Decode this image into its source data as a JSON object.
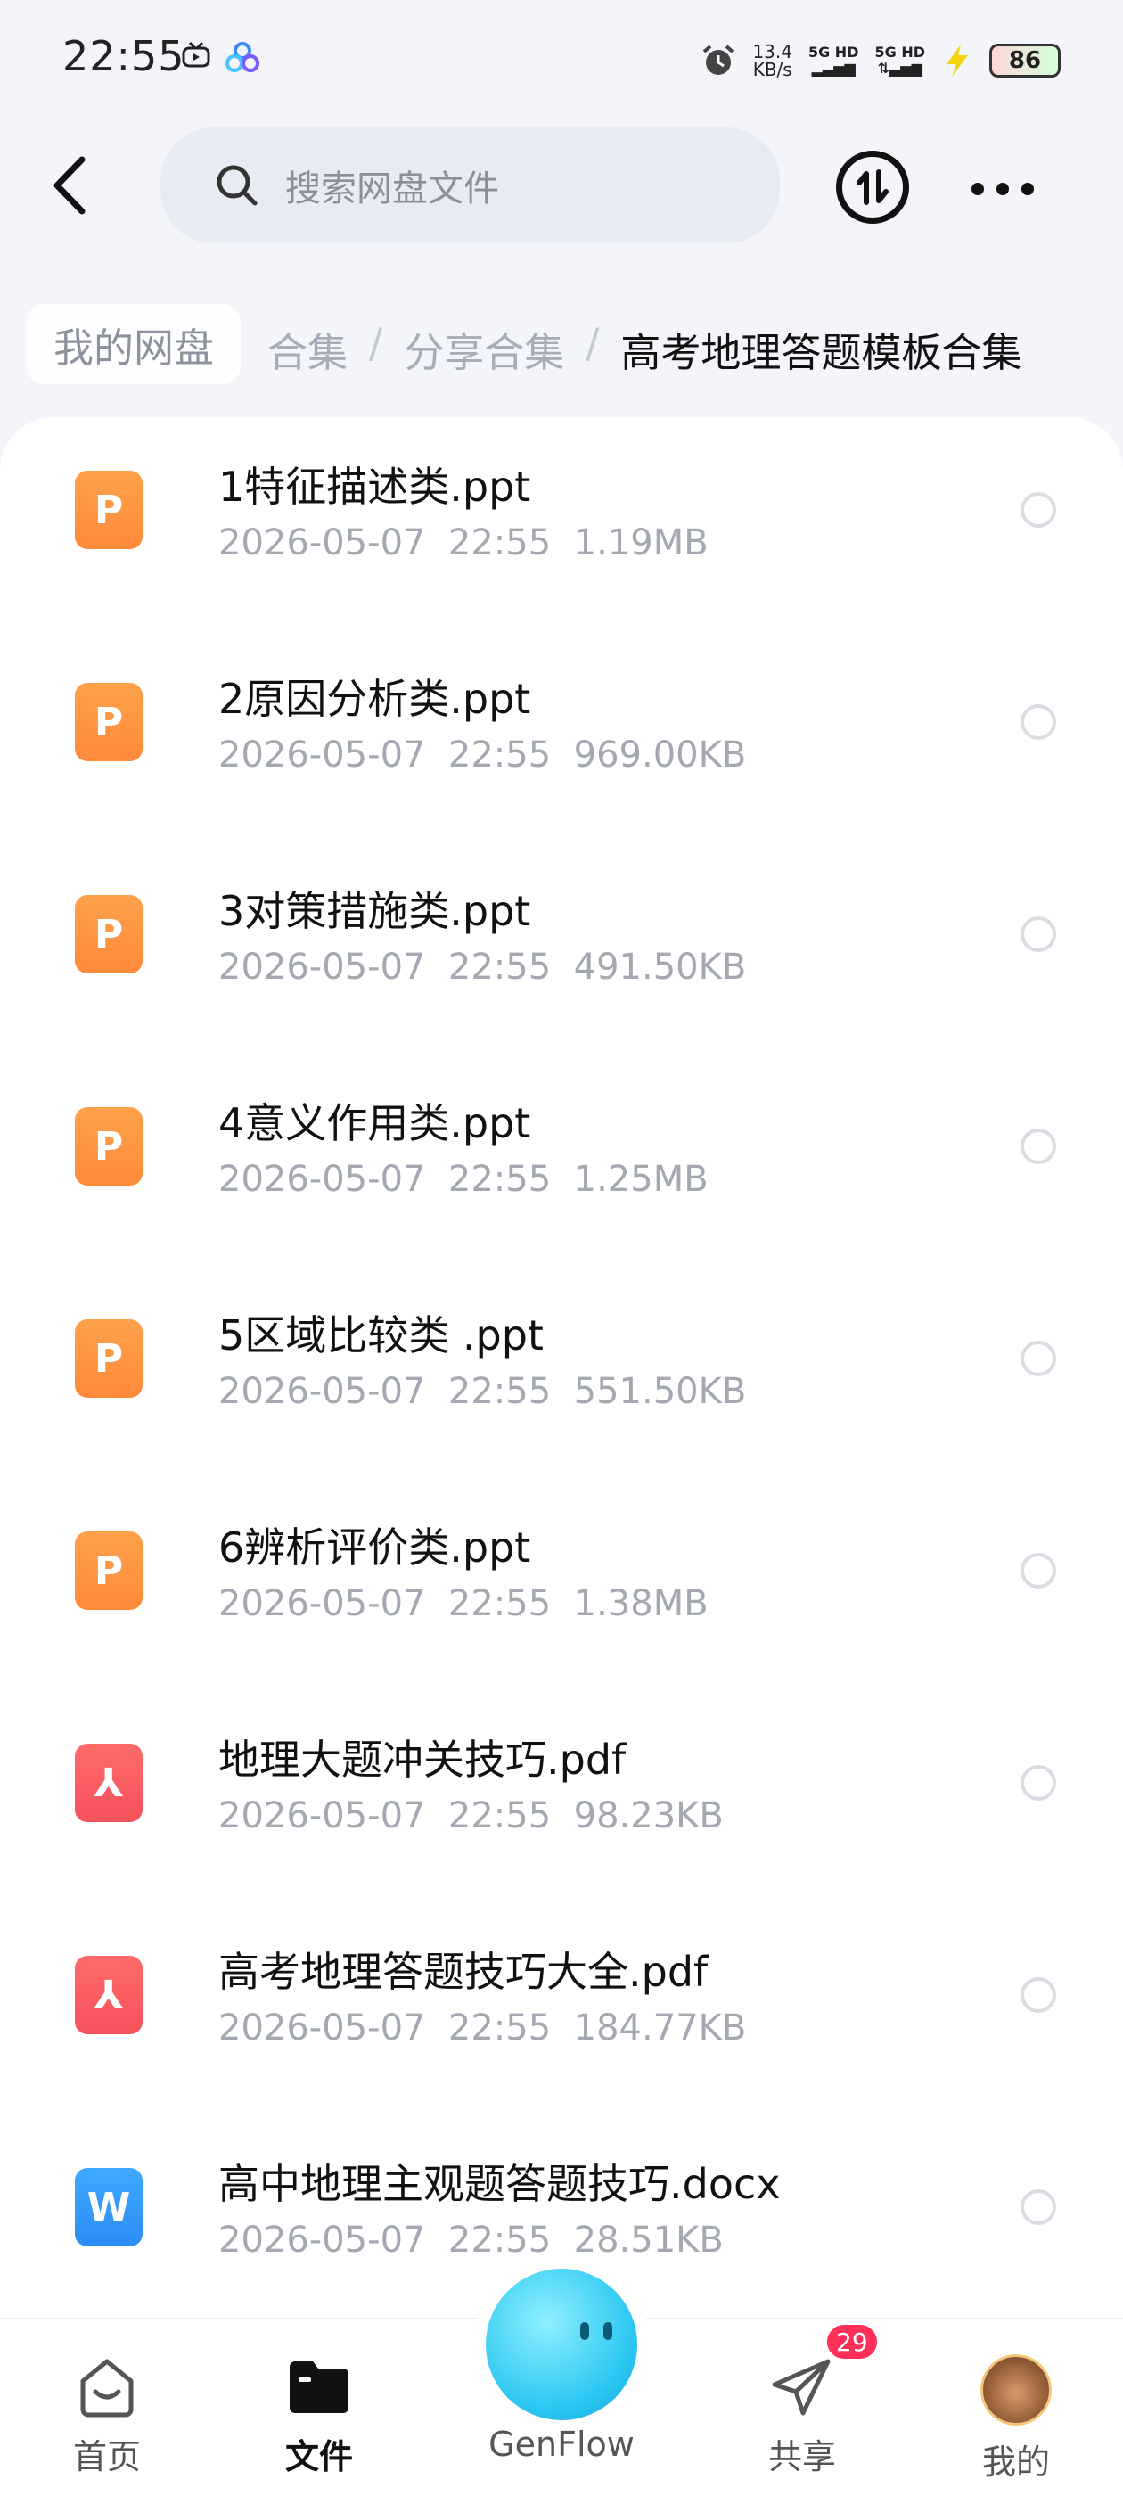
{
  "status_bar": {
    "time": "22:55",
    "net_speed_value": "13.4",
    "net_speed_unit": "KB/s",
    "sim1": "5G HD",
    "sim2": "5G HD",
    "battery": "86"
  },
  "header": {
    "search_placeholder": "搜索网盘文件"
  },
  "breadcrumb": {
    "home": "我的网盘",
    "partial": "合集",
    "middle": "分享合集",
    "current": "高考地理答题模板合集",
    "separator": "/"
  },
  "files": [
    {
      "name": "1特征描述类.ppt",
      "date": "2026-05-07",
      "time": "22:55",
      "size": "1.19MB",
      "type": "ppt",
      "icon_letter": "P"
    },
    {
      "name": "2原因分析类.ppt",
      "date": "2026-05-07",
      "time": "22:55",
      "size": "969.00KB",
      "type": "ppt",
      "icon_letter": "P"
    },
    {
      "name": "3对策措施类.ppt",
      "date": "2026-05-07",
      "time": "22:55",
      "size": "491.50KB",
      "type": "ppt",
      "icon_letter": "P"
    },
    {
      "name": "4意义作用类.ppt",
      "date": "2026-05-07",
      "time": "22:55",
      "size": "1.25MB",
      "type": "ppt",
      "icon_letter": "P"
    },
    {
      "name": "5区域比较类 .ppt",
      "date": "2026-05-07",
      "time": "22:55",
      "size": "551.50KB",
      "type": "ppt",
      "icon_letter": "P"
    },
    {
      "name": "6辨析评价类.ppt",
      "date": "2026-05-07",
      "time": "22:55",
      "size": "1.38MB",
      "type": "ppt",
      "icon_letter": "P"
    },
    {
      "name": "地理大题冲关技巧.pdf",
      "date": "2026-05-07",
      "time": "22:55",
      "size": "98.23KB",
      "type": "pdf",
      "icon_letter": "⅄"
    },
    {
      "name": "高考地理答题技巧大全.pdf",
      "date": "2026-05-07",
      "time": "22:55",
      "size": "184.77KB",
      "type": "pdf",
      "icon_letter": "⅄"
    },
    {
      "name": "高中地理主观题答题技巧.docx",
      "date": "2026-05-07",
      "time": "22:55",
      "size": "28.51KB",
      "type": "doc",
      "icon_letter": "W"
    }
  ],
  "tabbar": {
    "home": "首页",
    "files": "文件",
    "genflow": "GenFlow",
    "share": "共享",
    "share_badge": "29",
    "mine": "我的"
  },
  "colors": {
    "ppt": "#ff8f3c",
    "pdf": "#f4515b",
    "doc": "#2b8df5",
    "badge": "#ff2f58"
  }
}
